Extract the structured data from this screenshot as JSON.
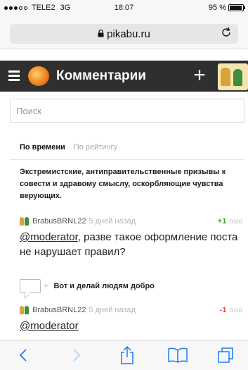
{
  "status_bar": {
    "carrier": "TELE2",
    "network": "3G",
    "time": "18:07",
    "battery_text": "95 %",
    "battery_level": 0.95
  },
  "browser": {
    "url": "pikabu.ru"
  },
  "app_bar": {
    "title": "Комментарии",
    "add_label": "+"
  },
  "search": {
    "placeholder": "Поиск"
  },
  "sort_tabs": [
    {
      "label": "По времени",
      "active": true
    },
    {
      "label": "По рейтингу",
      "active": false
    }
  ],
  "post": {
    "text": "Экстремистские, антиправительственные призывы к совести и здравому смыслу, оскорбляющие чувства верующих."
  },
  "comments": [
    {
      "author": "BrabusBRNL22",
      "ago": "5 дней назад",
      "rating": "+1",
      "mention": "@moderator",
      "text": ", разве такое оформление поста не нарушает правил?"
    },
    {
      "author": "BrabusBRNL22",
      "ago": "5 дней назад",
      "rating": "-1",
      "mention": "@moderator",
      "text": ""
    }
  ],
  "reply": {
    "plus": "+",
    "label": "Вот и делай людям добро"
  },
  "icons": {
    "more": "ooo"
  },
  "colors": {
    "accent": "#1a7cf5",
    "positive": "#4aa020",
    "negative": "#e24a2c",
    "app_bar": "#2f2f2f"
  }
}
